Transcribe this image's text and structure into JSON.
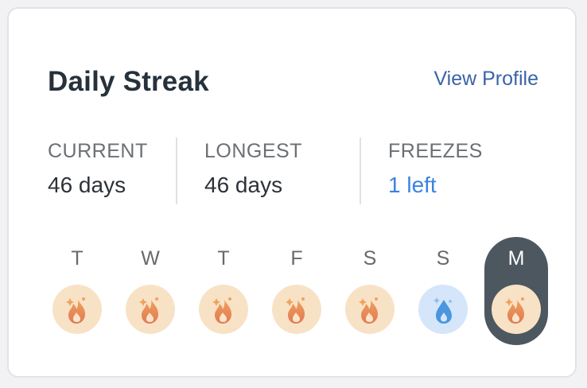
{
  "header": {
    "title": "Daily Streak",
    "view_profile_label": "View Profile"
  },
  "stats": [
    {
      "label": "CURRENT",
      "value": "46 days"
    },
    {
      "label": "LONGEST",
      "value": "46 days"
    },
    {
      "label": "FREEZES",
      "value": "1 left"
    }
  ],
  "week": [
    {
      "letter": "T",
      "status": "fire"
    },
    {
      "letter": "W",
      "status": "fire"
    },
    {
      "letter": "T",
      "status": "fire"
    },
    {
      "letter": "F",
      "status": "fire"
    },
    {
      "letter": "S",
      "status": "fire"
    },
    {
      "letter": "S",
      "status": "freeze"
    },
    {
      "letter": "M",
      "status": "fire",
      "today": true
    }
  ],
  "colors": {
    "accent_link": "#3a64a6",
    "freezes_value": "#3b82e0",
    "today_highlight": "#4d5760",
    "fire_badge_bg": "#f8e2c6",
    "freeze_badge_bg": "#d5e6fa"
  },
  "icons": {
    "fire": "flame-icon",
    "freeze": "water-drop-icon"
  }
}
